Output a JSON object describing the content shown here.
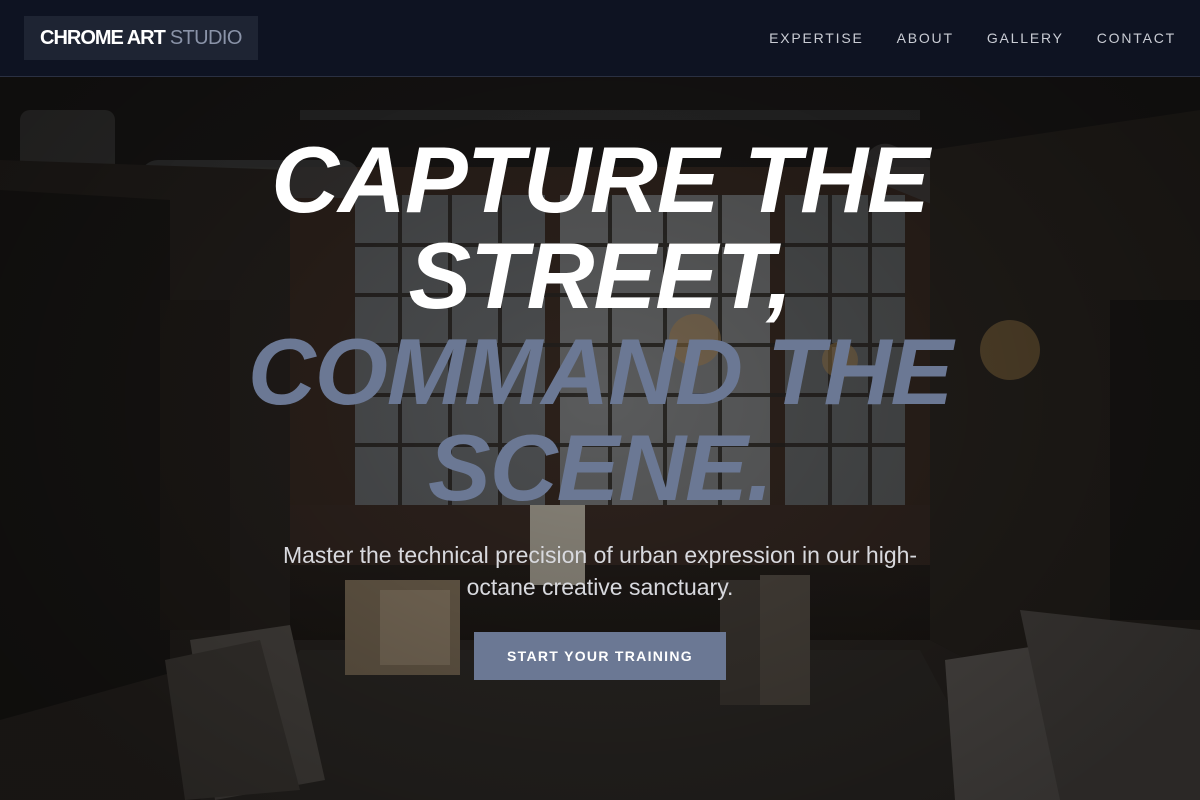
{
  "brand": {
    "primary": "CHROME ART",
    "secondary": "STUDIO"
  },
  "nav": {
    "items": [
      {
        "label": "EXPERTISE"
      },
      {
        "label": "ABOUT"
      },
      {
        "label": "GALLERY"
      },
      {
        "label": "CONTACT"
      }
    ]
  },
  "hero": {
    "headline_line1": "CAPTURE THE STREET,",
    "headline_line2": "COMMAND THE SCENE.",
    "subtitle": "Master the technical precision of urban expression in our high-octane creative sanctuary.",
    "cta_label": "START YOUR TRAINING",
    "background_image": "dark industrial art studio interior with large factory windows, chandeliers and stacked canvases"
  },
  "colors": {
    "navbar_bg": "#0e1322",
    "brand_box_bg": "#1e2433",
    "accent": "#6b7894",
    "headline_white": "#ffffff",
    "nav_text": "#c9ccd4"
  }
}
